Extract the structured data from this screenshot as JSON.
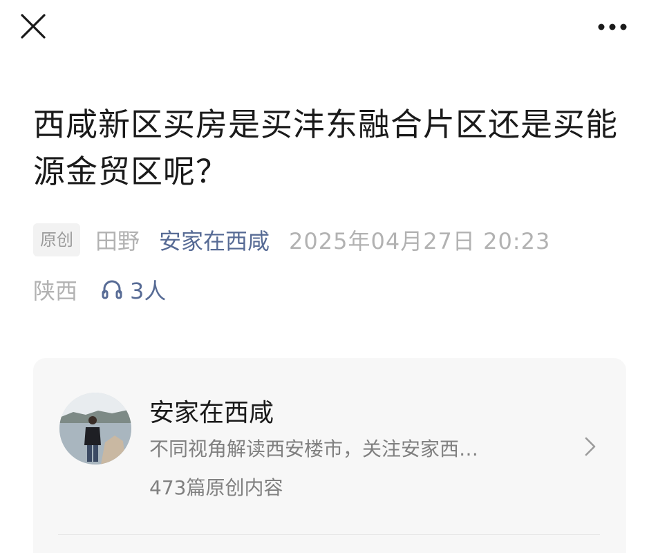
{
  "header": {
    "close_icon": "close-icon",
    "more_icon": "more-horizontal-icon"
  },
  "article": {
    "title": "西咸新区买房是买沣东融合片区还是买能源金贸区呢？",
    "original_tag": "原创",
    "author": "田野",
    "account_name": "安家在西咸",
    "datetime": "2025年04月27日 20:23",
    "location": "陕西",
    "listen_count": "3人",
    "listen_icon": "headphones-icon"
  },
  "profile_card": {
    "name": "安家在西咸",
    "description": "不同视角解读西安楼市，关注安家西…",
    "original_count": "473篇原创内容",
    "chevron_icon": "chevron-right-icon"
  },
  "colors": {
    "link": "#576b95",
    "meta": "#b2b2b2",
    "title": "#1a1a1a",
    "card_bg": "#f7f7f7"
  }
}
